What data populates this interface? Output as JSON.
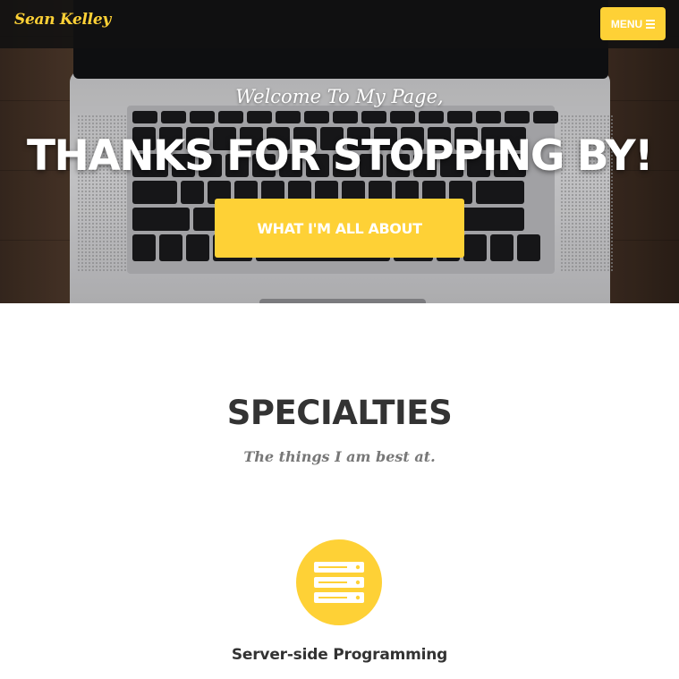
{
  "navbar": {
    "brand": "Sean Kelley",
    "menu_label": "MENU",
    "menu_icon": "bars-icon"
  },
  "hero": {
    "subheading": "Welcome To My Page,",
    "heading": "Thanks For Stopping By!",
    "cta_label": "What I'm All About"
  },
  "specialties": {
    "title": "Specialties",
    "subtitle": "The things I am best at.",
    "items": [
      {
        "icon": "server-icon",
        "title": "Server-side Programming"
      }
    ]
  },
  "colors": {
    "accent": "#fed136",
    "heading_text": "#333333",
    "muted_text": "#777777",
    "navbar_bg": "#111111"
  }
}
